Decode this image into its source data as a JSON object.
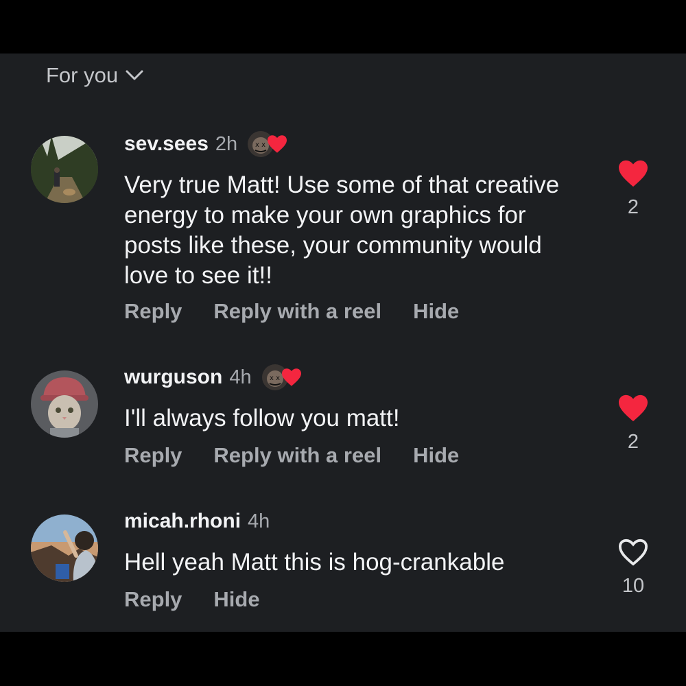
{
  "sort": {
    "label": "For you",
    "icon": "chevron-down-icon"
  },
  "colors": {
    "background": "#1d1f22",
    "frame": "#000000",
    "text_primary": "#f2f3f5",
    "text_secondary": "#a7aaaf",
    "heart_red": "#f4263f"
  },
  "comments": [
    {
      "username": "sev.sees",
      "time": "2h",
      "text": "Very true Matt! Use some of that creative energy to make your own graphics for posts like these, your community would love to see it!!",
      "liked_by_creator": true,
      "liked": true,
      "like_count": "2",
      "actions": [
        "Reply",
        "Reply with a reel",
        "Hide"
      ]
    },
    {
      "username": "wurguson",
      "time": "4h",
      "text": "I'll always follow you matt!",
      "liked_by_creator": true,
      "liked": true,
      "like_count": "2",
      "actions": [
        "Reply",
        "Reply with a reel",
        "Hide"
      ]
    },
    {
      "username": "micah.rhoni",
      "time": "4h",
      "text": "Hell yeah Matt this is hog-crankable",
      "liked_by_creator": false,
      "liked": false,
      "like_count": "10",
      "actions": [
        "Reply",
        "Hide"
      ]
    }
  ]
}
